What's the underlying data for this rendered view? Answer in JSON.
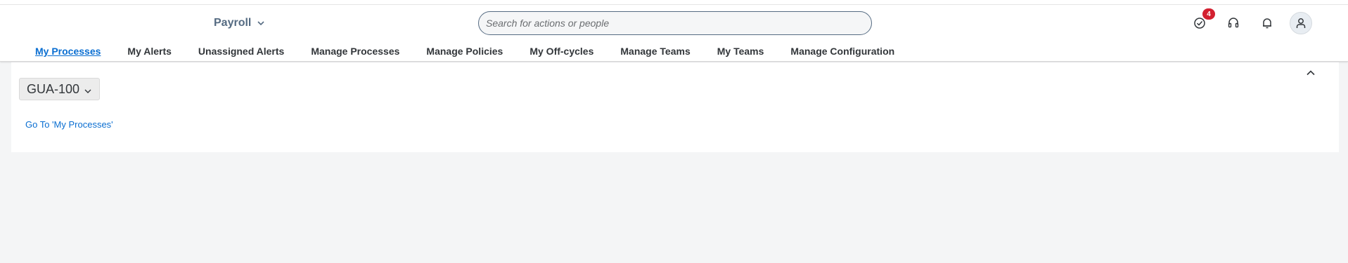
{
  "header": {
    "product_title": "Payroll",
    "search": {
      "placeholder": "Search for actions or people",
      "value": ""
    },
    "actions": {
      "tasks_badge": "4"
    }
  },
  "nav": {
    "tabs": [
      {
        "label": "My Processes",
        "active": true
      },
      {
        "label": "My Alerts"
      },
      {
        "label": "Unassigned Alerts"
      },
      {
        "label": "Manage Processes"
      },
      {
        "label": "Manage Policies"
      },
      {
        "label": "My Off-cycles"
      },
      {
        "label": "Manage Teams"
      },
      {
        "label": "My Teams"
      },
      {
        "label": "Manage Configuration"
      }
    ]
  },
  "content": {
    "variant_selector": "GUA-100",
    "goto_link": "Go To 'My Processes'"
  },
  "colors": {
    "accent": "#0a6ed1",
    "badge": "#d32030",
    "background": "#f4f5f6"
  }
}
